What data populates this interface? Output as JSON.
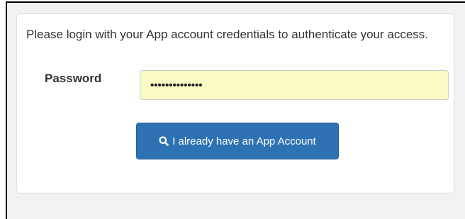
{
  "login": {
    "message": "Please login with your App account credentials to authenticate your access.",
    "password_label": "Password",
    "password_value": "..............",
    "button_label": "I already have an App Account",
    "button_icon": "search-icon"
  },
  "colors": {
    "button_bg": "#2e72b4",
    "input_autofill_bg": "#fafbc4",
    "text": "#333333"
  }
}
